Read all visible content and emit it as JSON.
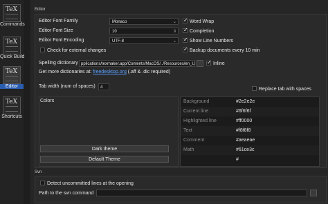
{
  "sidebar": {
    "items": [
      {
        "label": "Commands",
        "icon": "tex-commands-icon"
      },
      {
        "label": "Quick Build",
        "icon": "tex-quick-build-icon"
      },
      {
        "label": "Editor",
        "icon": "tex-editor-icon"
      },
      {
        "label": "Shortcuts",
        "icon": "tex-shortcuts-icon"
      }
    ],
    "icon_text": "TeX"
  },
  "editor": {
    "section_title": "Editor",
    "font_family_label": "Editor Font Family",
    "font_family_value": "Monaco",
    "font_size_label": "Editor Font Size",
    "font_size_value": "10",
    "encoding_label": "Editor Font Encoding",
    "encoding_value": "UTF-8",
    "check_external": "Check for external changes",
    "word_wrap": "Word Wrap",
    "completion": "Completion",
    "show_line_numbers": "Show Line Numbers",
    "backup": "Backup documents every 10 min",
    "spelling_label": "Spelling dictionary",
    "spelling_path": "pplications/texmaker.app/Contents/MacOS/../Resources/en_US.dic",
    "inline_label": "Inline",
    "more_dicts_prefix": "Get more dictionaries at: ",
    "more_dicts_link": "freedesktop.org",
    "more_dicts_suffix": " (.aff & .dic required)",
    "tab_width_label": "Tab width (num of spaces)",
    "tab_width_value": "4",
    "replace_tab_label": "Replace tab with spaces",
    "colors_label": "Colors",
    "dark_theme_button": "Dark theme",
    "default_theme_button": "Default Theme",
    "colors": [
      {
        "name": "Background",
        "value": "#2e2e2e"
      },
      {
        "name": "Current line",
        "value": "#6f6f6f"
      },
      {
        "name": "Highlighted line",
        "value": "#ff0000"
      },
      {
        "name": "Text",
        "value": "#f8f8f8"
      },
      {
        "name": "Comment",
        "value": "#aeaeae"
      },
      {
        "name": "Math",
        "value": "#61ce3c"
      },
      {
        "name": "",
        "value": "#"
      }
    ]
  },
  "svn": {
    "section_title": "Svn",
    "detect_label": "Detect uncommitted lines at the opening",
    "path_label": "Path to the svn command"
  }
}
